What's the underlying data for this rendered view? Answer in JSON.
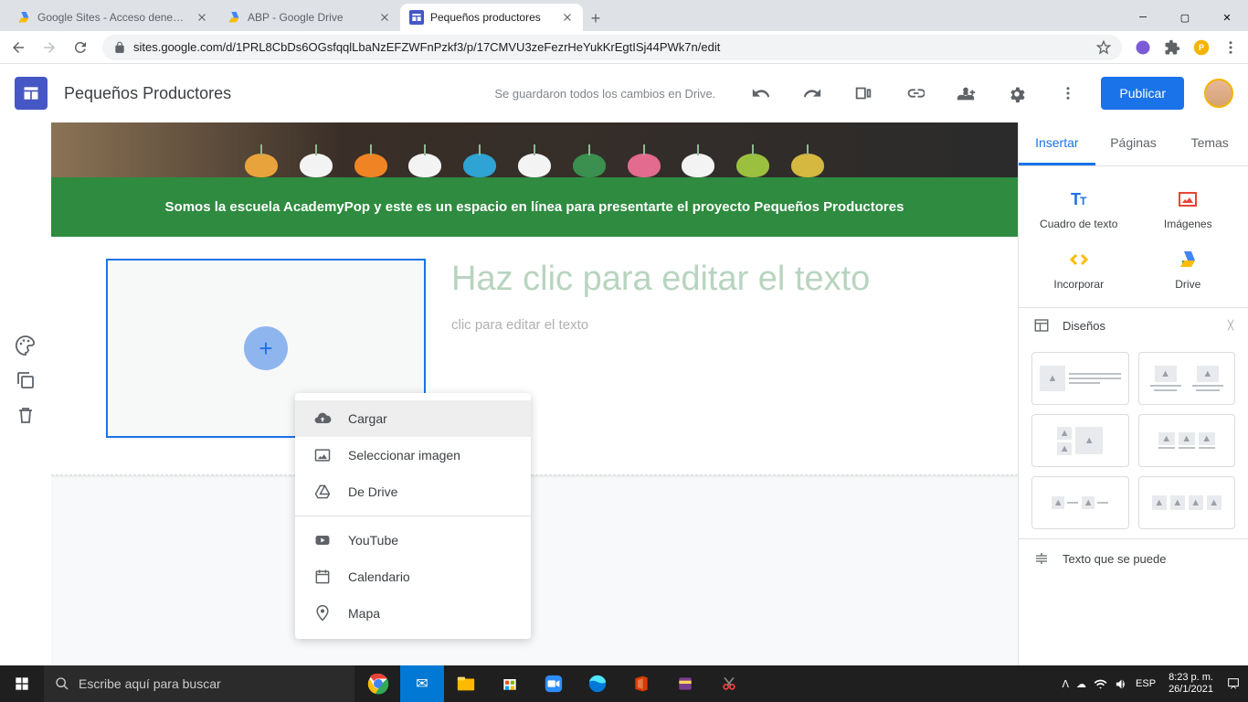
{
  "browser": {
    "tabs": [
      {
        "title": "Google Sites - Acceso denegado",
        "favicon": "drive"
      },
      {
        "title": "ABP - Google Drive",
        "favicon": "drive"
      },
      {
        "title": "Pequeños productores",
        "favicon": "sites"
      }
    ],
    "url": "sites.google.com/d/1PRL8CbDs6OGsfqqlLbaNzEFZWFnPzkf3/p/17CMVU3zeFezrHeYukKrEgtISj44PWk7n/edit"
  },
  "app": {
    "title": "Pequeños Productores",
    "save_status": "Se guardaron todos los cambios en Drive.",
    "publish_label": "Publicar"
  },
  "page": {
    "banner_text": "Somos la escuela AcademyPop y este es un espacio en línea para presentarte el proyecto Pequeños Productores",
    "text_title": "Haz clic para editar el texto",
    "text_body": "clic para editar el texto"
  },
  "dropdown": {
    "upload": "Cargar",
    "select_image": "Seleccionar imagen",
    "from_drive": "De Drive",
    "youtube": "YouTube",
    "calendar": "Calendario",
    "map": "Mapa"
  },
  "right_panel": {
    "tabs": {
      "insert": "Insertar",
      "pages": "Páginas",
      "themes": "Temas"
    },
    "text_box": "Cuadro de texto",
    "images": "Imágenes",
    "embed": "Incorporar",
    "drive": "Drive",
    "layouts": "Diseños",
    "collapsible_text": "Texto que se puede"
  },
  "taskbar": {
    "search_placeholder": "Escribe aquí para buscar",
    "lang": "ESP",
    "time": "8:23 p. m.",
    "date": "26/1/2021"
  }
}
